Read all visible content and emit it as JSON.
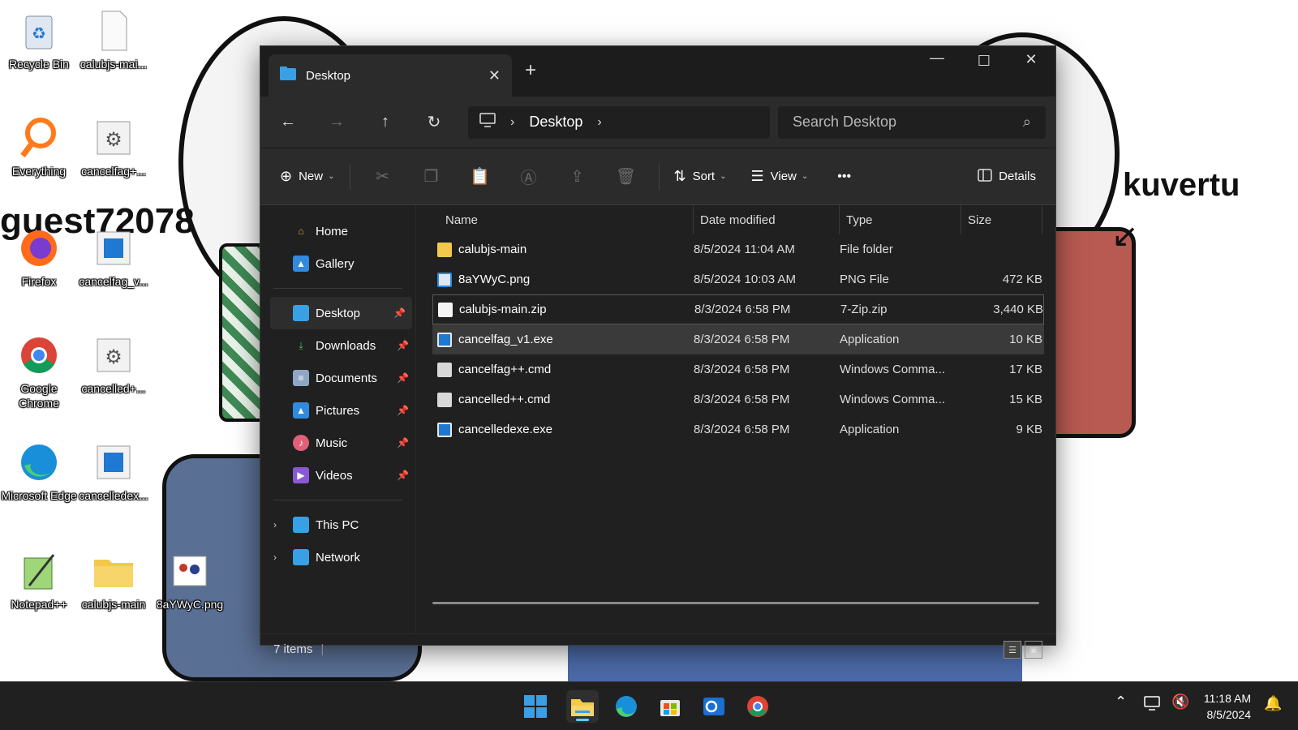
{
  "desktop_icons": [
    {
      "label": "Recycle Bin"
    },
    {
      "label": "calubjs-mai..."
    },
    {
      "label": "Everything"
    },
    {
      "label": "cancelfag+..."
    },
    {
      "label": "Firefox"
    },
    {
      "label": "cancelfag_v..."
    },
    {
      "label": "Google Chrome"
    },
    {
      "label": "cancelled+..."
    },
    {
      "label": "Microsoft Edge"
    },
    {
      "label": "cancelledex..."
    },
    {
      "label": "Notepad++"
    },
    {
      "label": "calubjs-main"
    },
    {
      "label": "8aYWyC.png"
    }
  ],
  "wallpaper": {
    "right_text": "kuvertu",
    "left_text": "guest72078"
  },
  "window": {
    "tab_title": "Desktop",
    "address": {
      "segment": "Desktop"
    },
    "search_placeholder": "Search Desktop",
    "toolbar": {
      "new_label": "New",
      "sort_label": "Sort",
      "view_label": "View",
      "more_label": "•••",
      "details_label": "Details"
    },
    "nav": {
      "home": "Home",
      "gallery": "Gallery",
      "desktop": "Desktop",
      "downloads": "Downloads",
      "documents": "Documents",
      "pictures": "Pictures",
      "music": "Music",
      "videos": "Videos",
      "this_pc": "This PC",
      "network": "Network"
    },
    "columns": {
      "name": "Name",
      "date": "Date modified",
      "type": "Type",
      "size": "Size"
    },
    "files": [
      {
        "name": "calubjs-main",
        "date": "8/5/2024 11:04 AM",
        "type": "File folder",
        "size": ""
      },
      {
        "name": "8aYWyC.png",
        "date": "8/5/2024 10:03 AM",
        "type": "PNG File",
        "size": "472 KB"
      },
      {
        "name": "calubjs-main.zip",
        "date": "8/3/2024 6:58 PM",
        "type": "7-Zip.zip",
        "size": "3,440 KB"
      },
      {
        "name": "cancelfag_v1.exe",
        "date": "8/3/2024 6:58 PM",
        "type": "Application",
        "size": "10 KB"
      },
      {
        "name": "cancelfag++.cmd",
        "date": "8/3/2024 6:58 PM",
        "type": "Windows Comma...",
        "size": "17 KB"
      },
      {
        "name": "cancelled++.cmd",
        "date": "8/3/2024 6:58 PM",
        "type": "Windows Comma...",
        "size": "15 KB"
      },
      {
        "name": "cancelledexe.exe",
        "date": "8/3/2024 6:58 PM",
        "type": "Application",
        "size": "9 KB"
      }
    ],
    "status": "7 items"
  },
  "taskbar": {
    "time": "11:18 AM",
    "date": "8/5/2024"
  },
  "colors": {
    "accent": "#60cdff",
    "folder": "#f2c94c",
    "window_bg": "#202020"
  }
}
